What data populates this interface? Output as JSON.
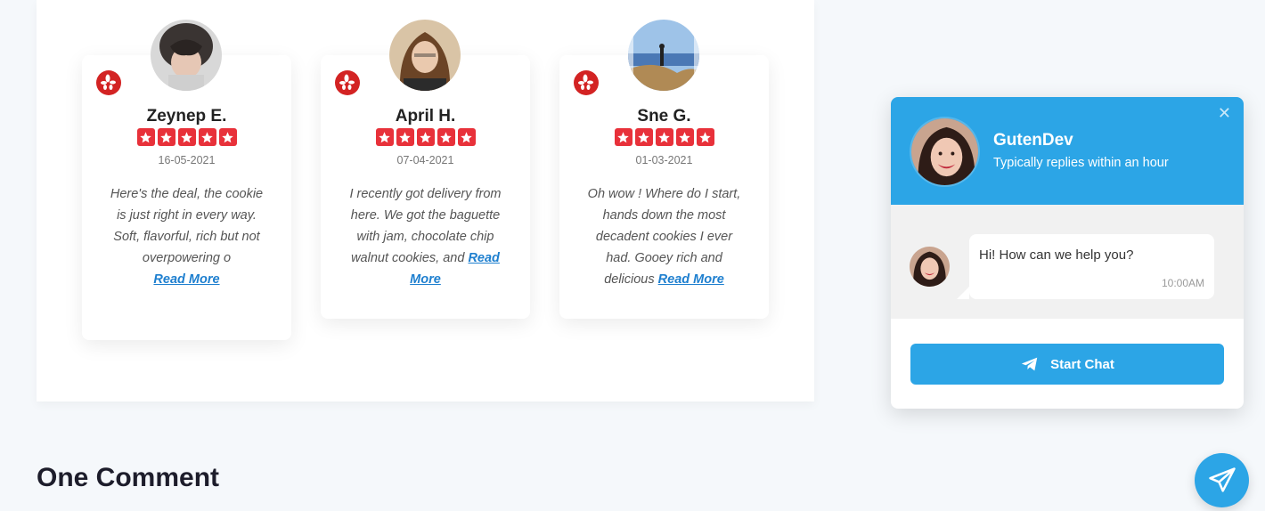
{
  "reviews": [
    {
      "name": "Zeynep E.",
      "rating": 5,
      "date": "16-05-2021",
      "text": "Here's the deal, the cookie is just right in every way. Soft, flavorful, rich but not overpowering o",
      "read_more": "Read More",
      "source_icon": "yelp-icon"
    },
    {
      "name": "April H.",
      "rating": 5,
      "date": "07-04-2021",
      "text": "I recently got delivery from here. We got the baguette with jam, chocolate chip walnut cookies, and",
      "read_more": "Read More",
      "source_icon": "yelp-icon"
    },
    {
      "name": "Sne G.",
      "rating": 5,
      "date": "01-03-2021",
      "text": "Oh wow ! Where do I start, hands down the most decadent cookies I ever had. Gooey rich and delicious",
      "read_more": "Read More",
      "source_icon": "yelp-icon"
    }
  ],
  "comments": {
    "title": "One Comment"
  },
  "chat": {
    "name": "GutenDev",
    "status": "Typically replies within an hour",
    "close_icon": "close-icon",
    "message": "Hi! How can we help you?",
    "message_time": "10:00AM",
    "start_button": "Start Chat",
    "button_icon": "telegram-icon"
  },
  "fab_icon": "paper-plane-icon",
  "colors": {
    "accent": "#2ca5e6",
    "star": "#e8313a",
    "yelp": "#d32323",
    "link": "#1e7fcf"
  }
}
